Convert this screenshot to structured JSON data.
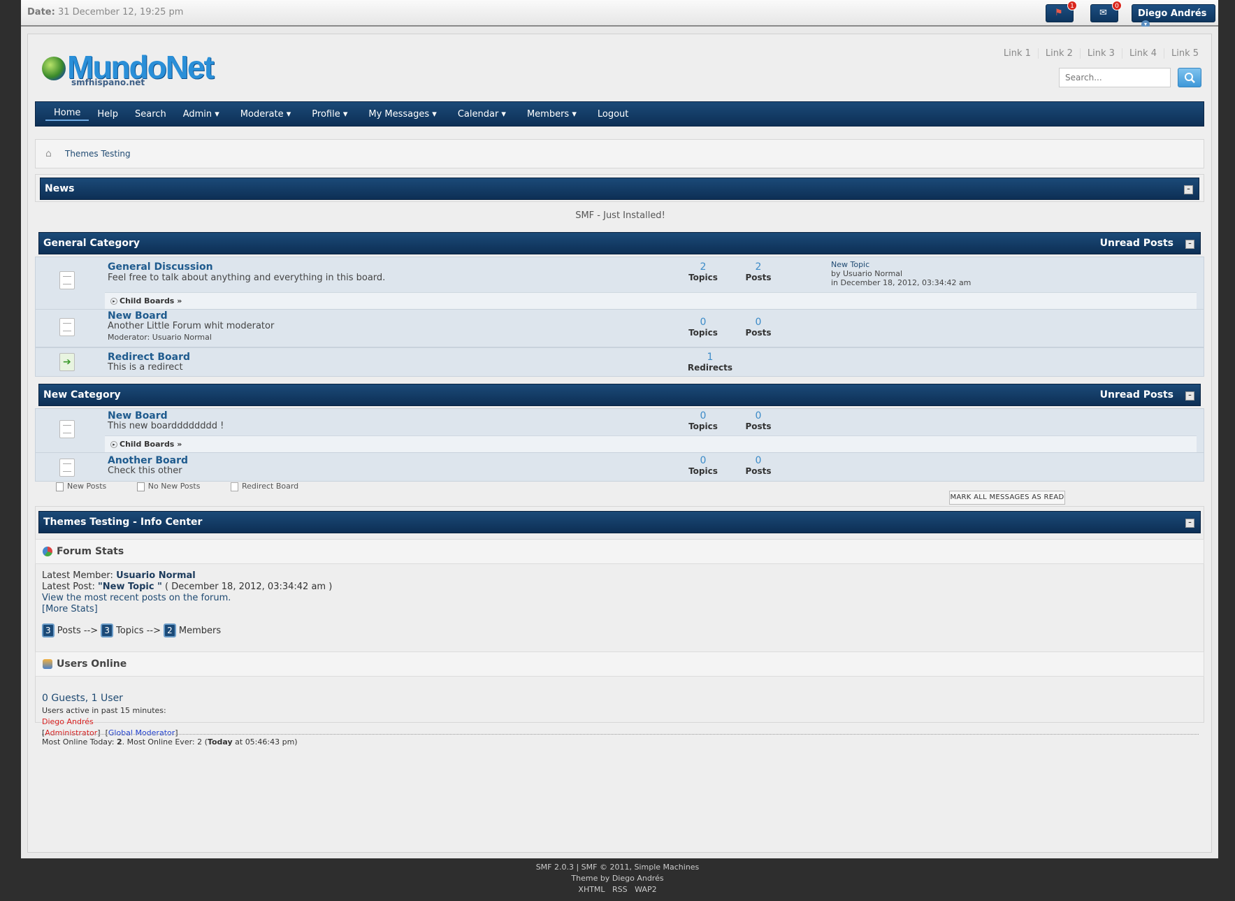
{
  "topbar": {
    "date_label": "Date:",
    "date_value": "31 December 12, 19:25 pm",
    "flag_badge": "1",
    "mail_badge": "0",
    "user_name": "Diego Andrés"
  },
  "header": {
    "logo_text": "MundoNet",
    "logo_sub": "smfhispano.net",
    "links": [
      "Link 1",
      "Link 2",
      "Link 3",
      "Link 4",
      "Link 5"
    ],
    "search_placeholder": "Search..."
  },
  "nav": [
    "Home",
    "Help",
    "Search",
    "Admin ▾",
    "Moderate ▾",
    "Profile ▾",
    "My Messages ▾",
    "Calendar ▾",
    "Members ▾",
    "Logout"
  ],
  "breadcrumb": "Themes Testing",
  "news": {
    "title": "News",
    "text": "SMF - Just Installed!"
  },
  "categories": [
    {
      "title": "General Category",
      "unread": "Unread Posts",
      "boards": [
        {
          "name": "General Discussion",
          "desc": "Feel free to talk about anything and everything in this board.",
          "topics": "2",
          "topics_label": "Topics",
          "posts": "2",
          "posts_label": "Posts",
          "last_title": "New Topic",
          "last_by": "by Usuario Normal",
          "last_in": "in December 18, 2012, 03:34:42 am",
          "child": "Child Boards »"
        },
        {
          "name": "New Board",
          "desc": "Another Little Forum whit moderator",
          "moderator": "Moderator: Usuario Normal",
          "topics": "0",
          "topics_label": "Topics",
          "posts": "0",
          "posts_label": "Posts"
        },
        {
          "name": "Redirect Board",
          "desc": "This is a redirect",
          "redirects": "1",
          "redirects_label": "Redirects"
        }
      ]
    },
    {
      "title": "New Category",
      "unread": "Unread Posts",
      "boards": [
        {
          "name": "New Board",
          "desc": "This new boardddddddd !",
          "topics": "0",
          "topics_label": "Topics",
          "posts": "0",
          "posts_label": "Posts",
          "child": "Child Boards »"
        },
        {
          "name": "Another Board",
          "desc": "Check this other",
          "topics": "0",
          "topics_label": "Topics",
          "posts": "0",
          "posts_label": "Posts"
        }
      ]
    }
  ],
  "legend": [
    "New Posts",
    "No New Posts",
    "Redirect Board"
  ],
  "mark_read": "MARK ALL MESSAGES AS READ",
  "info": {
    "title": "Themes Testing - Info Center",
    "stats_title": "Forum Stats",
    "latest_member_label": "Latest Member:",
    "latest_member": "Usuario Normal",
    "latest_post_label": "Latest Post:",
    "latest_post": "\"New Topic \"",
    "latest_post_date": "( December 18, 2012, 03:34:42 am )",
    "recent_link": "View the most recent posts on the forum.",
    "more_stats": "[More Stats]",
    "posts_n": "3",
    "posts_label": "Posts -->",
    "topics_n": "3",
    "topics_label": "Topics -->",
    "members_n": "2",
    "members_label": "Members",
    "online_title": "Users Online",
    "online_count": "0 Guests, 1 User",
    "active_label": "Users active in past 15 minutes:",
    "active_user": "Diego Andrés",
    "group_admin": "Administrator",
    "group_mod": "Global Moderator",
    "most_online_a": "Most Online Today: ",
    "most_online_today": "2",
    "most_online_b": ". Most Online Ever: 2 (",
    "most_online_today_word": "Today",
    "most_online_c": " at 05:46:43 pm)"
  },
  "footer": {
    "line1": "SMF 2.0.3 | SMF © 2011, Simple Machines",
    "line2": "Theme by Diego Andrés",
    "line3": "XHTML   RSS   WAP2"
  }
}
